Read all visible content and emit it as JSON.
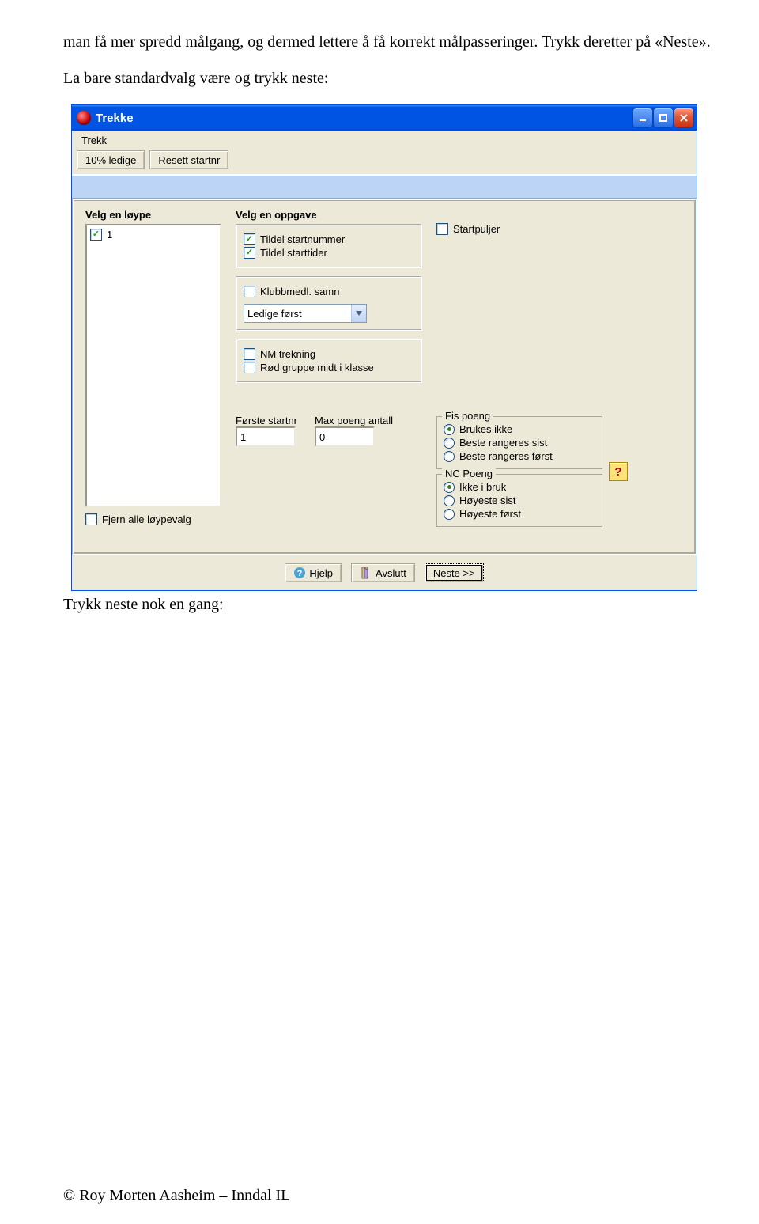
{
  "doc": {
    "p1": "man få mer spredd målgang, og dermed lettere å få korrekt målpasseringer. Trykk deretter på «Neste».",
    "p2": "La bare standardvalg være og trykk neste:",
    "p3": "Trykk neste nok en gang:",
    "footer": "© Roy Morten Aasheim – Inndal IL"
  },
  "window": {
    "title": "Trekke",
    "menu": {
      "trekk": "Trekk"
    },
    "toolbar": {
      "ledige": "10% ledige",
      "resett": "Resett startnr"
    },
    "left": {
      "heading": "Velg en løype",
      "item1": "1",
      "fjern": "Fjern alle løypevalg"
    },
    "mid": {
      "heading": "Velg en oppgave",
      "tildel_startnr": "Tildel startnummer",
      "tildel_starttid": "Tildel starttider",
      "klubbmedl": "Klubbmedl. samn",
      "combo": "Ledige først",
      "nm": "NM trekning",
      "rod": "Rød gruppe midt i klasse",
      "forste_lbl": "Første startnr",
      "forste_val": "1",
      "max_lbl": "Max poeng antall",
      "max_val": "0"
    },
    "right": {
      "startpuljer": "Startpuljer",
      "fis_legend": "Fis poeng",
      "fis_a": "Brukes ikke",
      "fis_b": "Beste rangeres sist",
      "fis_c": "Beste rangeres først",
      "nc_legend": "NC Poeng",
      "nc_a": "Ikke i bruk",
      "nc_b": "Høyeste sist",
      "nc_c": "Høyeste først",
      "help_q": "?"
    },
    "footer": {
      "hjelp": "Hjelp",
      "avslutt": "Avslutt",
      "neste": "Neste >>"
    }
  }
}
